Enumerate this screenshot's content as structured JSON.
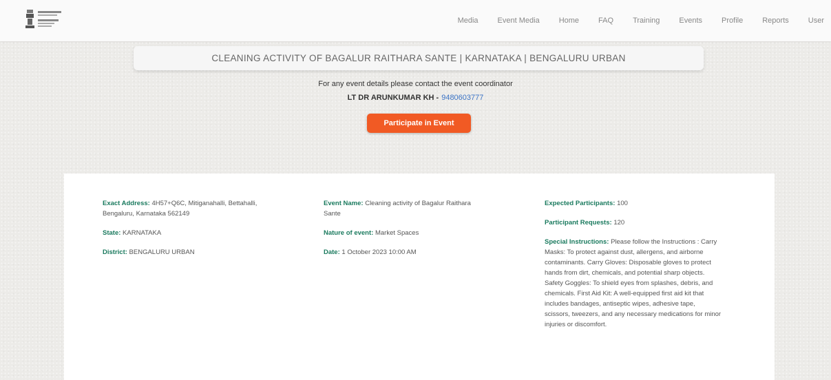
{
  "nav": {
    "items": [
      "Media",
      "Event Media",
      "Home",
      "FAQ",
      "Training",
      "Events",
      "Profile",
      "Reports",
      "User"
    ]
  },
  "event": {
    "title": "CLEANING ACTIVITY OF BAGALUR RAITHARA SANTE | KARNATAKA | BENGALURU URBAN",
    "contact_text": "For any event details please contact the event coordinator",
    "coordinator_name": "LT DR ARUNKUMAR KH -",
    "coordinator_phone": "9480603777",
    "participate_label": "Participate in Event"
  },
  "details": {
    "exact_address": {
      "label": "Exact Address:",
      "value": "4H57+Q6C, Mitiganahalli, Bettahalli, Bengaluru, Karnataka 562149"
    },
    "state": {
      "label": "State:",
      "value": "KARNATAKA"
    },
    "district": {
      "label": "District:",
      "value": "BENGALURU URBAN"
    },
    "event_name": {
      "label": "Event Name:",
      "value": "Cleaning activity of Bagalur Raithara Sante"
    },
    "nature": {
      "label": "Nature of event:",
      "value": "Market Spaces"
    },
    "date": {
      "label": "Date:",
      "value": "1 October 2023 10:00 AM"
    },
    "expected": {
      "label": "Expected Participants:",
      "value": "100"
    },
    "requests": {
      "label": "Participant Requests:",
      "value": "120"
    },
    "special": {
      "label": "Special Instructions:",
      "value": "Please follow the Instructions : Carry Masks: To protect against dust, allergens, and airborne contaminants. Carry Gloves: Disposable gloves to protect hands from dirt, chemicals, and potential sharp objects. Safety Goggles: To shield eyes from splashes, debris, and chemicals. First Aid Kit: A well-equipped first aid kit that includes bandages, antiseptic wipes, adhesive tape, scissors, tweezers, and any necessary medications for minor injuries or discomfort."
    }
  }
}
